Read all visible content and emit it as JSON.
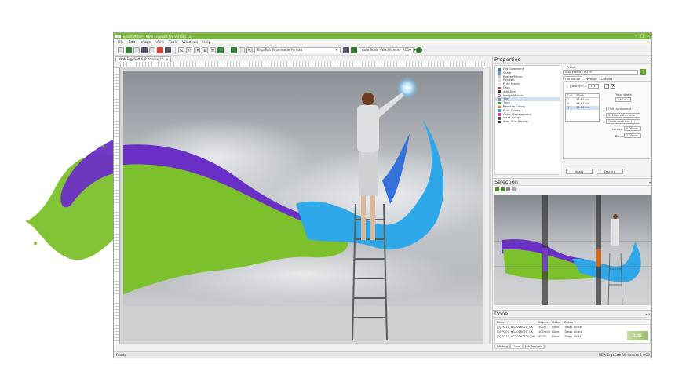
{
  "window": {
    "title": "ErgoSoft RIP - NEW ErgoSoft RIP Version 15",
    "min": "–",
    "max": "□",
    "close": "✕"
  },
  "menu": [
    "File",
    "Edit",
    "Image",
    "View",
    "Tools",
    "Windows",
    "Help"
  ],
  "toolbar": {
    "printer": "ErgoSoft Supermode Portrait",
    "tile_mode": "Auto Scale - Wall Panels - RO16"
  },
  "document": {
    "tab_label": "NEW ErgoSoft RIP Version 15",
    "tab_close": "x"
  },
  "properties": {
    "title": "Properties",
    "pin": "▾",
    "items": [
      "File Comment",
      "Scale",
      "Rotate/Mirror",
      "Position",
      "Print Marks",
      "Crop",
      "Add/Dev",
      "Image Margin",
      "Tile",
      "Tune",
      "Replace Colors",
      "Pure Colors",
      "Color Management",
      "Mask Image",
      "Step And Repeat"
    ],
    "selected_item": "Tile",
    "preset_label": "Preset",
    "preset_value": "Wall Panels - RO16",
    "subtabs": [
      "Horizontal",
      "Vertical",
      "Options"
    ],
    "columns_label": "Columns: 3",
    "columns_value": "1/3",
    "width_header_col": "Col...",
    "width_header": "Width",
    "widths": [
      {
        "col": "1",
        "width": "46.67 cm"
      },
      {
        "col": "2",
        "width": "46.67 cm"
      },
      {
        "col": "3",
        "width": "46.66 cm"
      }
    ],
    "total_width_label": "Total Width",
    "total_width": "140.00 cm",
    "overlap_mode": "Half transparent",
    "overlap_side": "50% on either side",
    "cut_line": "Outer each line (1)",
    "overlap_label": "Overlap",
    "overlap_value": "0.00 cm",
    "bleed_label": "Bleed",
    "bleed_value": "2.00 cm",
    "apply": "Apply",
    "discard": "Discard"
  },
  "selection": {
    "title": "Selection",
    "pin": "▾"
  },
  "done": {
    "title": "Done",
    "controls": "▾ ✕",
    "headers": [
      "Done",
      "Copies",
      "Status",
      "Ready"
    ],
    "rows": [
      {
        "name": "[0] PO15_NG2016070_OK",
        "copies": "30/30",
        "status": "Done",
        "ready": "Today 15:46"
      },
      {
        "name": "[0] PO07_NG2016050_OK",
        "copies": "100/100",
        "status": "Done",
        "ready": "Today 15:44"
      },
      {
        "name": "[0] PO15_NG20160620_OK",
        "copies": "50/50",
        "status": "Done",
        "ready": "Today 15:41"
      }
    ],
    "badge": "DONE",
    "tabs": [
      "Waiting",
      "Done",
      "Job Preview"
    ],
    "active_tab": "Done"
  },
  "status": {
    "left": "Ready",
    "right": "NEW ErgoSoft RIP Version 1 RGB"
  },
  "colors": {
    "titlebar": "#7cb83e",
    "paint_green": "#7cc12c",
    "paint_purple": "#6a2fc4",
    "paint_blue": "#2ea8e8"
  }
}
